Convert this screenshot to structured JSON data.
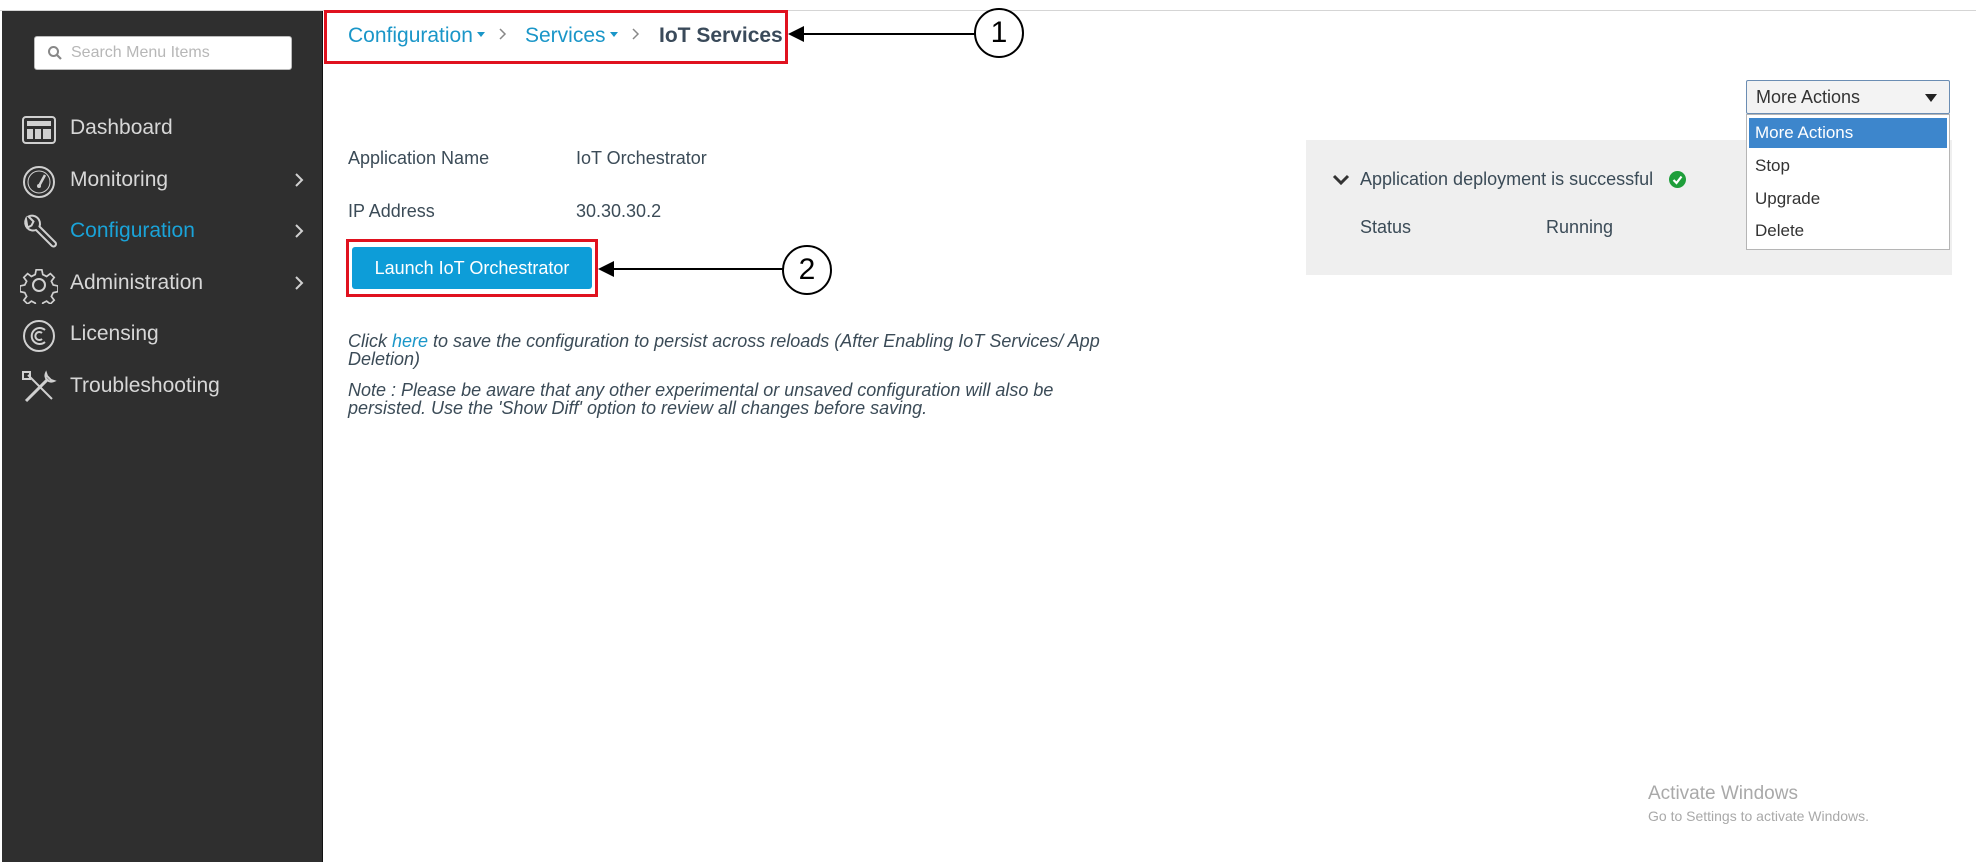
{
  "sidebar": {
    "search_placeholder": "Search Menu Items",
    "items": [
      {
        "label": "Dashboard",
        "icon": "dashboard-icon",
        "has_submenu": false,
        "active": false
      },
      {
        "label": "Monitoring",
        "icon": "gauge-icon",
        "has_submenu": true,
        "active": false
      },
      {
        "label": "Configuration",
        "icon": "wrench-icon",
        "has_submenu": true,
        "active": true
      },
      {
        "label": "Administration",
        "icon": "gear-icon",
        "has_submenu": true,
        "active": false
      },
      {
        "label": "Licensing",
        "icon": "licensing-icon",
        "has_submenu": false,
        "active": false
      },
      {
        "label": "Troubleshooting",
        "icon": "tools-icon",
        "has_submenu": false,
        "active": false
      }
    ]
  },
  "breadcrumb": {
    "items": [
      "Configuration",
      "Services"
    ],
    "current": "IoT Services"
  },
  "annotations": {
    "marker_1": "1",
    "marker_2": "2"
  },
  "details": {
    "app_name_label": "Application Name",
    "app_name_value": "IoT Orchestrator",
    "ip_label": "IP Address",
    "ip_value": "30.30.30.2"
  },
  "launch_button": "Launch IoT Orchestrator",
  "save_note": {
    "prefix": "Click ",
    "link": "here",
    "suffix_line1": " to save the configuration to persist across reloads (After Enabling IoT Services/ App",
    "line2": "Deletion)"
  },
  "warning_note": {
    "line1": "Note : Please be aware that any other experimental or unsaved configuration will also be",
    "line2": "persisted. Use the 'Show Diff' option to review all changes before saving."
  },
  "status_panel": {
    "title": "Application deployment is successful",
    "status_label": "Status",
    "status_value": "Running"
  },
  "actions": {
    "selected": "More Actions",
    "options": [
      "More Actions",
      "Stop",
      "Upgrade",
      "Delete"
    ]
  },
  "watermark": {
    "title": "Activate Windows",
    "subtitle": "Go to Settings to activate Windows."
  },
  "colors": {
    "sidebar_bg": "#2f2f2f",
    "accent": "#1a96c8",
    "button": "#0d9dd8",
    "highlight_box": "#e0121f",
    "success": "#1e9e3a",
    "dropdown_selected": "#3d86cc"
  }
}
